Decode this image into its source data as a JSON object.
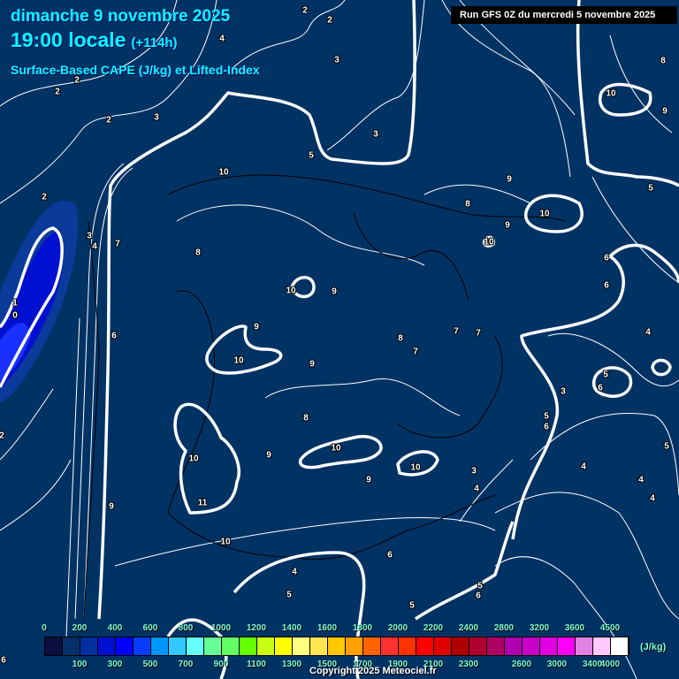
{
  "header": {
    "date": "dimanche 9 novembre 2025",
    "local_time": "19:00 locale",
    "lead": "(+114h)",
    "parameter": "Surface-Based CAPE (J/kg) et Lifted-Index",
    "run": "Run GFS 0Z du mercredi 5 novembre 2025"
  },
  "colors": {
    "background": "#003264",
    "contour": "#ffffff",
    "border": "#000000"
  },
  "legend": {
    "unit": "(J/kg)",
    "top_labels": [
      "0",
      "200",
      "400",
      "600",
      "800",
      "1000",
      "1200",
      "1400",
      "1600",
      "1800",
      "2000",
      "2200",
      "2400",
      "2800",
      "3200",
      "3600",
      "4500"
    ],
    "bottom_labels": [
      "100",
      "300",
      "500",
      "700",
      "900",
      "1100",
      "1300",
      "1500",
      "1700",
      "1900",
      "2100",
      "2300",
      "2600",
      "3000",
      "3400",
      "4000"
    ],
    "swatches": [
      "#0a0f40",
      "#06306a",
      "#0030a0",
      "#0010d0",
      "#0000ff",
      "#0a3cff",
      "#0096ff",
      "#30c8ff",
      "#64ffff",
      "#64ff96",
      "#64ff64",
      "#64ff00",
      "#c8ff14",
      "#ffff00",
      "#ffff80",
      "#ffe650",
      "#ffc800",
      "#ffa000",
      "#ff6400",
      "#ff3232",
      "#ff3200",
      "#ff0000",
      "#e10000",
      "#af0000",
      "#af0032",
      "#af0064",
      "#af00af",
      "#c800c8",
      "#e100e1",
      "#ff00ff",
      "#e182e1",
      "#ffc8ff",
      "#ffffff"
    ]
  },
  "lifted_index_labels": [
    "2",
    "2",
    "4",
    "2",
    "2",
    "3",
    "2",
    "3",
    "3",
    "5",
    "10",
    "2",
    "3",
    "4",
    "7",
    "8",
    "10",
    "9",
    "1",
    "0",
    "6",
    "9",
    "10",
    "9",
    "8",
    "7",
    "7",
    "7",
    "8",
    "10",
    "9",
    "10",
    "10",
    "9",
    "3",
    "4",
    "11",
    "9",
    "10",
    "6",
    "4",
    "5",
    "5",
    "5",
    "6",
    "9",
    "8",
    "10",
    "9",
    "10",
    "6",
    "6",
    "4",
    "3",
    "5",
    "6",
    "5",
    "6",
    "4",
    "5",
    "4",
    "4",
    "10",
    "9",
    "8",
    "5",
    "2",
    "6"
  ],
  "copyright": "Copyright 2025 Meteociel.fr"
}
